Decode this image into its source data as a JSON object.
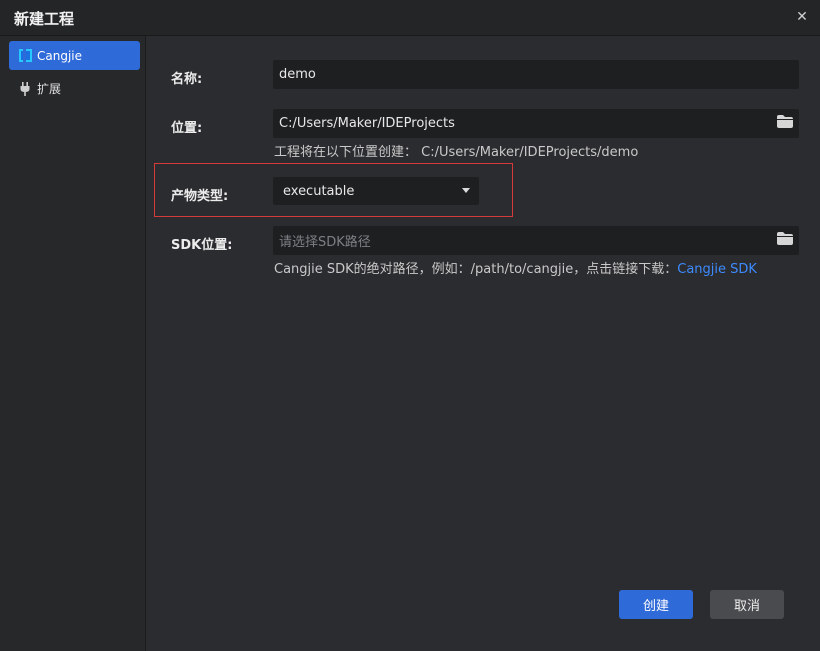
{
  "window": {
    "title": "新建工程"
  },
  "sidebar": {
    "items": [
      {
        "label": "Cangjie",
        "icon": "cangjie-icon",
        "active": true
      },
      {
        "label": "扩展",
        "icon": "plug-icon",
        "active": false
      }
    ]
  },
  "form": {
    "name_label": "名称:",
    "name_value": "demo",
    "location_label": "位置:",
    "location_value": "C:/Users/Maker/IDEProjects",
    "location_hint": "工程将在以下位置创建：  C:/Users/Maker/IDEProjects/demo",
    "product_type_label": "产物类型:",
    "product_type_value": "executable",
    "sdk_label": "SDK位置:",
    "sdk_placeholder": "请选择SDK路径",
    "sdk_hint": "Cangjie SDK的绝对路径，例如：/path/to/cangjie，点击链接下载：",
    "sdk_link": "Cangjie SDK"
  },
  "footer": {
    "create_label": "创建",
    "cancel_label": "取消"
  },
  "colors": {
    "accent": "#2f6ad9",
    "link": "#3c8bff",
    "highlight": "#d43a3a"
  }
}
